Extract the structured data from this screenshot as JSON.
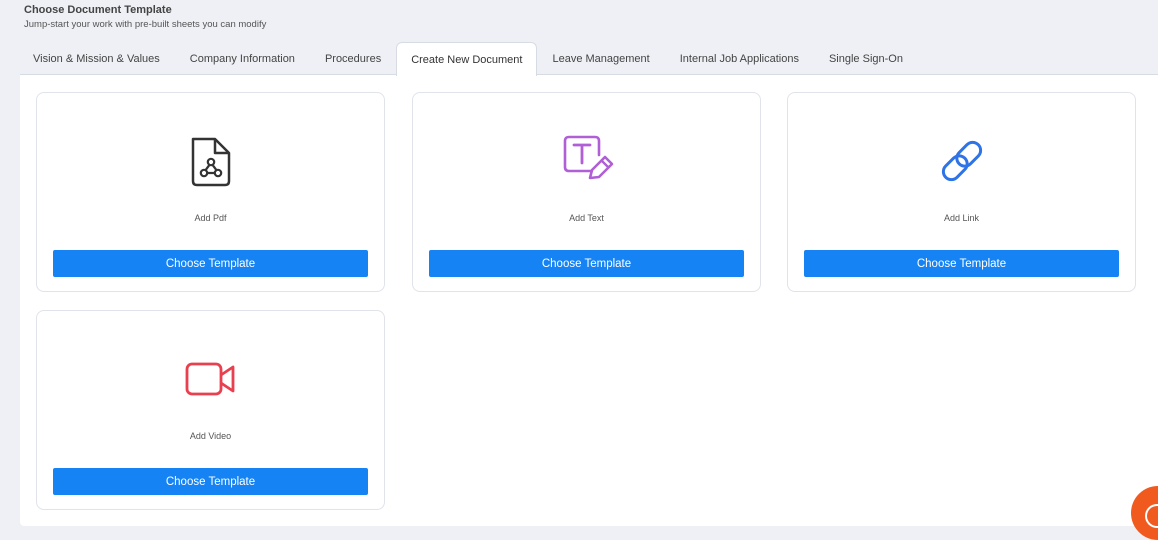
{
  "header": {
    "title": "Choose Document Template",
    "subtitle": "Jump-start your work with pre-built sheets you can modify"
  },
  "tabs": [
    {
      "label": "Vision & Mission & Values",
      "active": false
    },
    {
      "label": "Company Information",
      "active": false
    },
    {
      "label": "Procedures",
      "active": false
    },
    {
      "label": "Create New Document",
      "active": true
    },
    {
      "label": "Leave Management",
      "active": false
    },
    {
      "label": "Internal Job Applications",
      "active": false
    },
    {
      "label": "Single Sign-On",
      "active": false
    }
  ],
  "cards": [
    {
      "label": "Add Pdf",
      "icon": "pdf-file-icon",
      "icon_color": "#333333",
      "button": "Choose Template"
    },
    {
      "label": "Add Text",
      "icon": "text-edit-icon",
      "icon_color": "#b05fd6",
      "button": "Choose Template"
    },
    {
      "label": "Add Link",
      "icon": "link-icon",
      "icon_color": "#2f74e6",
      "button": "Choose Template"
    },
    {
      "label": "Add Video",
      "icon": "video-camera-icon",
      "icon_color": "#e8404e",
      "button": "Choose Template"
    }
  ],
  "colors": {
    "accent": "#1683f5",
    "chat": "#f05a1f"
  }
}
